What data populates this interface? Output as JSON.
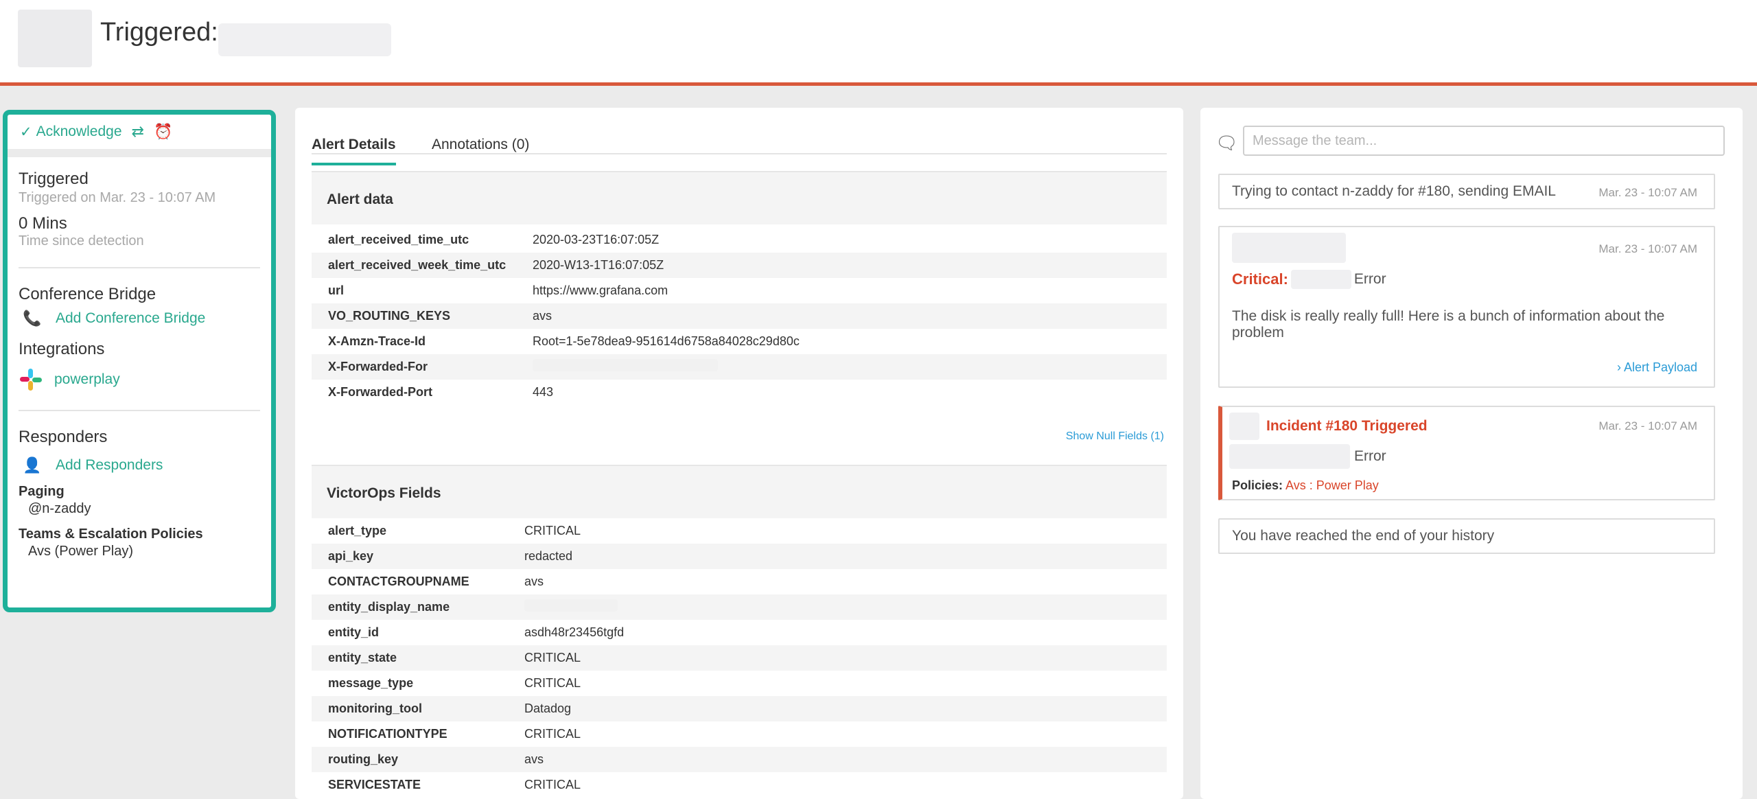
{
  "header": {
    "title": "Triggered:"
  },
  "left": {
    "toolbar": {
      "acknowledge": "Acknowledge"
    },
    "status": {
      "state": "Triggered",
      "triggered_on": "Triggered on Mar. 23 - 10:07 AM",
      "elapsed": "0 Mins",
      "elapsed_label": "Time since detection"
    },
    "conference": {
      "heading": "Conference Bridge",
      "add_label": "Add Conference Bridge"
    },
    "integrations": {
      "heading": "Integrations",
      "item": "powerplay"
    },
    "responders": {
      "heading": "Responders",
      "add_label": "Add Responders",
      "paging_label": "Paging",
      "paging_value": "@n-zaddy",
      "teams_label": "Teams & Escalation Policies",
      "teams_value": "Avs (Power Play)"
    }
  },
  "tabs": [
    {
      "label": "Alert Details",
      "active": true
    },
    {
      "label": "Annotations (0)",
      "active": false
    }
  ],
  "alert_data": {
    "title": "Alert data",
    "rows": [
      {
        "key": "alert_received_time_utc",
        "value": "2020-03-23T16:07:05Z"
      },
      {
        "key": "alert_received_week_time_utc",
        "value": "2020-W13-1T16:07:05Z"
      },
      {
        "key": "url",
        "value": "https://www.grafana.com"
      },
      {
        "key": "VO_ROUTING_KEYS",
        "value": "avs"
      },
      {
        "key": "X-Amzn-Trace-Id",
        "value": "Root=1-5e78dea9-951614d6758a84028c29d80c"
      },
      {
        "key": "X-Forwarded-For",
        "value": ""
      },
      {
        "key": "X-Forwarded-Port",
        "value": "443"
      }
    ],
    "show_null": "Show Null Fields (1)"
  },
  "victorops": {
    "title": "VictorOps Fields",
    "rows": [
      {
        "key": "alert_type",
        "value": "CRITICAL"
      },
      {
        "key": "api_key",
        "value": "redacted"
      },
      {
        "key": "CONTACTGROUPNAME",
        "value": "avs"
      },
      {
        "key": "entity_display_name",
        "value": ""
      },
      {
        "key": "entity_id",
        "value": "asdh48r23456tgfd"
      },
      {
        "key": "entity_state",
        "value": "CRITICAL"
      },
      {
        "key": "message_type",
        "value": "CRITICAL"
      },
      {
        "key": "monitoring_tool",
        "value": "Datadog"
      },
      {
        "key": "NOTIFICATIONTYPE",
        "value": "CRITICAL"
      },
      {
        "key": "routing_key",
        "value": "avs"
      },
      {
        "key": "SERVICESTATE",
        "value": "CRITICAL"
      }
    ]
  },
  "timeline": {
    "placeholder": "Message the team...",
    "contact": {
      "text": "Trying to contact n-zaddy for #180, sending EMAIL",
      "time": "Mar. 23 - 10:07 AM"
    },
    "alert": {
      "time": "Mar. 23 - 10:07 AM",
      "severity": "Critical:",
      "suffix": "Error",
      "body": "The disk is really really full! Here is a bunch of information about the problem",
      "payload_link": "› Alert Payload"
    },
    "incident": {
      "title": "Incident #180 Triggered",
      "time": "Mar. 23 - 10:07 AM",
      "suffix": "Error",
      "policies_label": "Policies:",
      "policies_value": "Avs : Power Play"
    },
    "end": "You have reached the end of your history"
  },
  "colors": {
    "accent": "#1eb09a",
    "brand_red": "#d9583b",
    "link_blue": "#2a9bd6"
  }
}
